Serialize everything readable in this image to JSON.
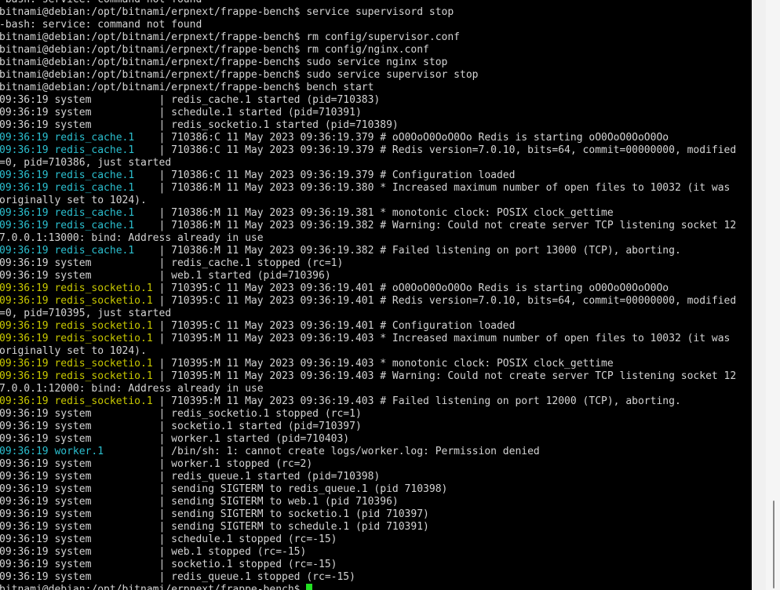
{
  "terminal": {
    "lines": [
      [
        {
          "t": "-bash: service: command not found",
          "c": "default"
        }
      ],
      [
        {
          "t": "bitnami@debian:/opt/bitnami/erpnext/frappe-bench$ service supervisord stop",
          "c": "default"
        }
      ],
      [
        {
          "t": "-bash: service: command not found",
          "c": "default"
        }
      ],
      [
        {
          "t": "bitnami@debian:/opt/bitnami/erpnext/frappe-bench$ rm config/supervisor.conf",
          "c": "default"
        }
      ],
      [
        {
          "t": "bitnami@debian:/opt/bitnami/erpnext/frappe-bench$ rm config/nginx.conf",
          "c": "default"
        }
      ],
      [
        {
          "t": "bitnami@debian:/opt/bitnami/erpnext/frappe-bench$ sudo service nginx stop",
          "c": "default"
        }
      ],
      [
        {
          "t": "bitnami@debian:/opt/bitnami/erpnext/frappe-bench$ sudo service supervisor stop",
          "c": "default"
        }
      ],
      [
        {
          "t": "bitnami@debian:/opt/bitnami/erpnext/frappe-bench$ bench start",
          "c": "default"
        }
      ],
      [
        {
          "t": "09:36:19 system           | redis_cache.1 started (pid=710383)",
          "c": "default"
        }
      ],
      [
        {
          "t": "09:36:19 system           | schedule.1 started (pid=710391)",
          "c": "default"
        }
      ],
      [
        {
          "t": "09:36:19 system           | redis_socketio.1 started (pid=710389)",
          "c": "default"
        }
      ],
      [
        {
          "t": "09:36:19 redis_cache.1    ",
          "c": "cyan"
        },
        {
          "t": "| 710386:C 11 May 2023 09:36:19.379 # oO0OoO0OoO0Oo Redis is starting oO0OoO0OoO0Oo",
          "c": "default"
        }
      ],
      [
        {
          "t": "09:36:19 redis_cache.1    ",
          "c": "cyan"
        },
        {
          "t": "| 710386:C 11 May 2023 09:36:19.379 # Redis version=7.0.10, bits=64, commit=00000000, modified",
          "c": "default"
        }
      ],
      [
        {
          "t": "=0, pid=710386, just started",
          "c": "default"
        }
      ],
      [
        {
          "t": "09:36:19 redis_cache.1    ",
          "c": "cyan"
        },
        {
          "t": "| 710386:C 11 May 2023 09:36:19.379 # Configuration loaded",
          "c": "default"
        }
      ],
      [
        {
          "t": "09:36:19 redis_cache.1    ",
          "c": "cyan"
        },
        {
          "t": "| 710386:M 11 May 2023 09:36:19.380 * Increased maximum number of open files to 10032 (it was",
          "c": "default"
        }
      ],
      [
        {
          "t": "originally set to 1024).",
          "c": "default"
        }
      ],
      [
        {
          "t": "09:36:19 redis_cache.1    ",
          "c": "cyan"
        },
        {
          "t": "| 710386:M 11 May 2023 09:36:19.381 * monotonic clock: POSIX clock_gettime",
          "c": "default"
        }
      ],
      [
        {
          "t": "09:36:19 redis_cache.1    ",
          "c": "cyan"
        },
        {
          "t": "| 710386:M 11 May 2023 09:36:19.382 # Warning: Could not create server TCP listening socket 12",
          "c": "default"
        }
      ],
      [
        {
          "t": "7.0.0.1:13000: bind: Address already in use",
          "c": "default"
        }
      ],
      [
        {
          "t": "09:36:19 redis_cache.1    ",
          "c": "cyan"
        },
        {
          "t": "| 710386:M 11 May 2023 09:36:19.382 # Failed listening on port 13000 (TCP), aborting.",
          "c": "default"
        }
      ],
      [
        {
          "t": "09:36:19 system           | redis_cache.1 stopped (rc=1)",
          "c": "default"
        }
      ],
      [
        {
          "t": "09:36:19 system           | web.1 started (pid=710396)",
          "c": "default"
        }
      ],
      [
        {
          "t": "09:36:19 redis_socketio.1 ",
          "c": "yellow"
        },
        {
          "t": "| 710395:C 11 May 2023 09:36:19.401 # oO0OoO0OoO0Oo Redis is starting oO0OoO0OoO0Oo",
          "c": "default"
        }
      ],
      [
        {
          "t": "09:36:19 redis_socketio.1 ",
          "c": "yellow"
        },
        {
          "t": "| 710395:C 11 May 2023 09:36:19.401 # Redis version=7.0.10, bits=64, commit=00000000, modified",
          "c": "default"
        }
      ],
      [
        {
          "t": "=0, pid=710395, just started",
          "c": "default"
        }
      ],
      [
        {
          "t": "09:36:19 redis_socketio.1 ",
          "c": "yellow"
        },
        {
          "t": "| 710395:C 11 May 2023 09:36:19.401 # Configuration loaded",
          "c": "default"
        }
      ],
      [
        {
          "t": "09:36:19 redis_socketio.1 ",
          "c": "yellow"
        },
        {
          "t": "| 710395:M 11 May 2023 09:36:19.403 * Increased maximum number of open files to 10032 (it was",
          "c": "default"
        }
      ],
      [
        {
          "t": "originally set to 1024).",
          "c": "default"
        }
      ],
      [
        {
          "t": "09:36:19 redis_socketio.1 ",
          "c": "yellow"
        },
        {
          "t": "| 710395:M 11 May 2023 09:36:19.403 * monotonic clock: POSIX clock_gettime",
          "c": "default"
        }
      ],
      [
        {
          "t": "09:36:19 redis_socketio.1 ",
          "c": "yellow"
        },
        {
          "t": "| 710395:M 11 May 2023 09:36:19.403 # Warning: Could not create server TCP listening socket 12",
          "c": "default"
        }
      ],
      [
        {
          "t": "7.0.0.1:12000: bind: Address already in use",
          "c": "default"
        }
      ],
      [
        {
          "t": "09:36:19 redis_socketio.1 ",
          "c": "yellow"
        },
        {
          "t": "| 710395:M 11 May 2023 09:36:19.403 # Failed listening on port 12000 (TCP), aborting.",
          "c": "default"
        }
      ],
      [
        {
          "t": "09:36:19 system           | redis_socketio.1 stopped (rc=1)",
          "c": "default"
        }
      ],
      [
        {
          "t": "09:36:19 system           | socketio.1 started (pid=710397)",
          "c": "default"
        }
      ],
      [
        {
          "t": "09:36:19 system           | worker.1 started (pid=710403)",
          "c": "default"
        }
      ],
      [
        {
          "t": "09:36:19 worker.1         ",
          "c": "cyan"
        },
        {
          "t": "| /bin/sh: 1: cannot create logs/worker.log: Permission denied",
          "c": "default"
        }
      ],
      [
        {
          "t": "09:36:19 system           | worker.1 stopped (rc=2)",
          "c": "default"
        }
      ],
      [
        {
          "t": "09:36:19 system           | redis_queue.1 started (pid=710398)",
          "c": "default"
        }
      ],
      [
        {
          "t": "09:36:19 system           | sending SIGTERM to redis_queue.1 (pid 710398)",
          "c": "default"
        }
      ],
      [
        {
          "t": "09:36:19 system           | sending SIGTERM to web.1 (pid 710396)",
          "c": "default"
        }
      ],
      [
        {
          "t": "09:36:19 system           | sending SIGTERM to socketio.1 (pid 710397)",
          "c": "default"
        }
      ],
      [
        {
          "t": "09:36:19 system           | sending SIGTERM to schedule.1 (pid 710391)",
          "c": "default"
        }
      ],
      [
        {
          "t": "09:36:19 system           | schedule.1 stopped (rc=-15)",
          "c": "default"
        }
      ],
      [
        {
          "t": "09:36:19 system           | web.1 stopped (rc=-15)",
          "c": "default"
        }
      ],
      [
        {
          "t": "09:36:19 system           | socketio.1 stopped (rc=-15)",
          "c": "default"
        }
      ],
      [
        {
          "t": "09:36:19 system           | redis_queue.1 stopped (rc=-15)",
          "c": "default"
        }
      ]
    ],
    "prompt": "bitnami@debian:/opt/bitnami/erpnext/frappe-bench$ ",
    "colors": {
      "background": "#000000",
      "default": "#d4d4d4",
      "cyan": "#2bbfcf",
      "yellow": "#c8c800",
      "cursor": "#22e022"
    }
  },
  "scrollbar": {
    "position_fraction": 1.0
  }
}
